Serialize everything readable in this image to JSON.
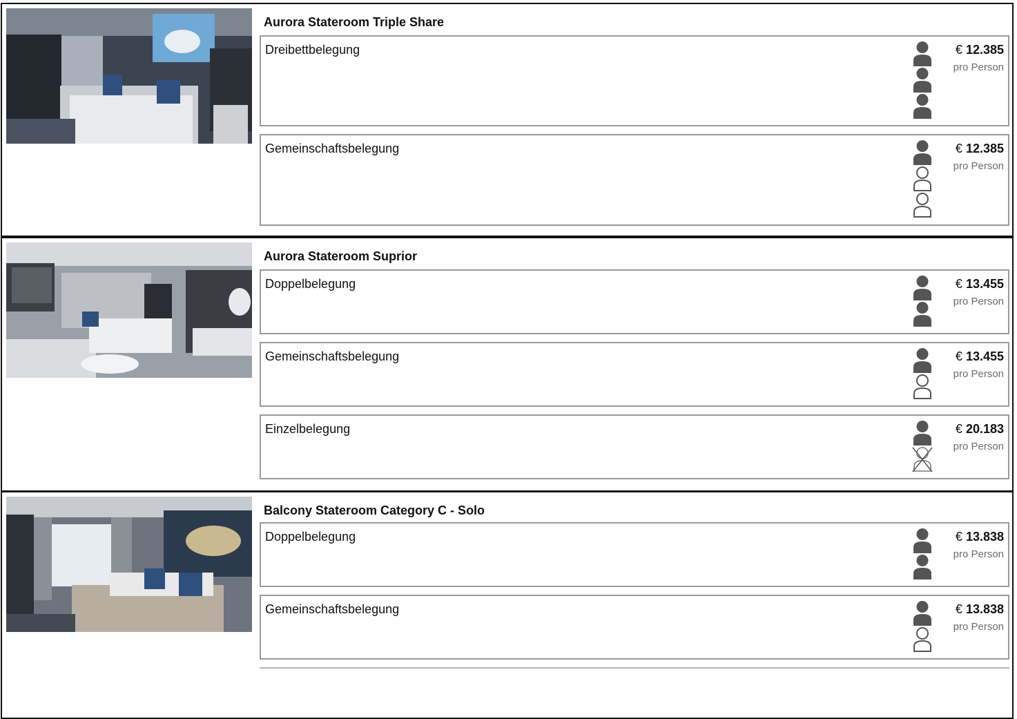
{
  "cabins": [
    {
      "title": "Aurora Stateroom Triple Share",
      "photo": "cabin-photo-aurora-triple",
      "options": [
        {
          "label": "Dreibettbelegung",
          "persons": [
            "filled",
            "filled",
            "filled"
          ],
          "currency": "€",
          "price": "12.385",
          "price_note": "pro Person"
        },
        {
          "label": "Gemeinschaftsbelegung",
          "persons": [
            "filled",
            "outline",
            "outline"
          ],
          "currency": "€",
          "price": "12.385",
          "price_note": "pro Person"
        }
      ]
    },
    {
      "title": "Aurora Stateroom Suprior",
      "photo": "cabin-photo-aurora-superior",
      "options": [
        {
          "label": "Doppelbelegung",
          "persons": [
            "filled",
            "filled"
          ],
          "currency": "€",
          "price": "13.455",
          "price_note": "pro Person"
        },
        {
          "label": "Gemeinschaftsbelegung",
          "persons": [
            "filled",
            "outline"
          ],
          "currency": "€",
          "price": "13.455",
          "price_note": "pro Person"
        },
        {
          "label": "Einzelbelegung",
          "persons": [
            "filled",
            "crossed"
          ],
          "currency": "€",
          "price": "20.183",
          "price_note": "pro Person"
        }
      ]
    },
    {
      "title": "Balcony Stateroom Category C - Solo",
      "photo": "cabin-photo-balcony-c",
      "options": [
        {
          "label": "Doppelbelegung",
          "persons": [
            "filled",
            "filled"
          ],
          "currency": "€",
          "price": "13.838",
          "price_note": "pro Person"
        },
        {
          "label": "Gemeinschaftsbelegung",
          "persons": [
            "filled",
            "outline"
          ],
          "currency": "€",
          "price": "13.838",
          "price_note": "pro Person"
        }
      ]
    }
  ],
  "colors": {
    "person_filled": "#555555",
    "person_outline": "#555555",
    "border_option": "#9a9a9a",
    "border_cabin": "#111111"
  }
}
